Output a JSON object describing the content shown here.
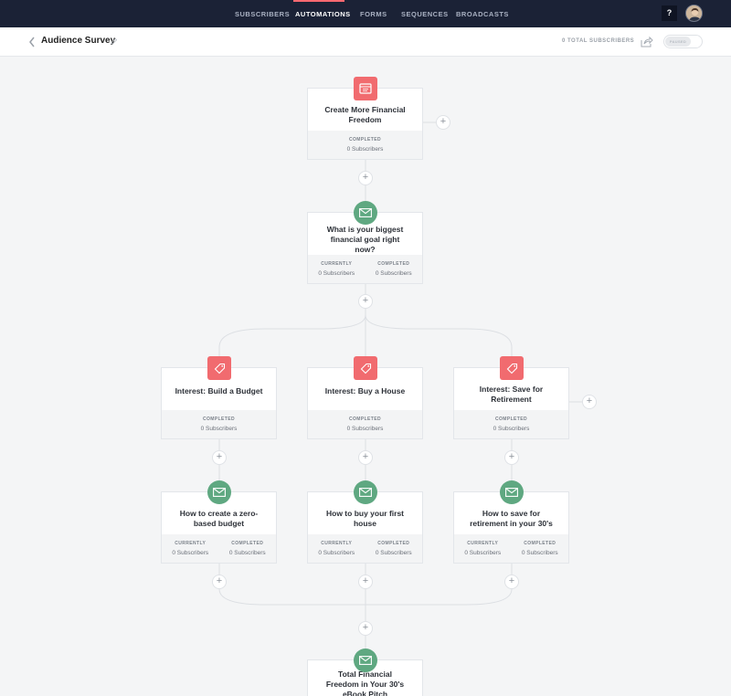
{
  "nav": {
    "items": [
      {
        "label": "SUBSCRIBERS",
        "active": false
      },
      {
        "label": "AUTOMATIONS",
        "active": true
      },
      {
        "label": "FORMS",
        "active": false
      },
      {
        "label": "SEQUENCES",
        "active": false
      },
      {
        "label": "BROADCASTS",
        "active": false
      }
    ],
    "help_label": "?",
    "accent_color": "#fb6970",
    "background_color": "#1b2236"
  },
  "subheader": {
    "title": "Audience Survey",
    "subscriber_count": "0 TOTAL SUBSCRIBERS",
    "toggle_label": "PAUSED"
  },
  "icons": {
    "back": "chevron-left-icon",
    "edit": "pencil-icon",
    "share": "share-icon",
    "action": "tag-icon",
    "form": "form-icon",
    "email": "envelope-icon"
  },
  "colors": {
    "action_node": "#f16b6f",
    "email_node": "#5fa881",
    "canvas": "#f4f5f6"
  },
  "nodes": {
    "trigger": {
      "title": "Create More Financial Freedom",
      "stats": [
        {
          "label": "COMPLETED",
          "value": "0 Subscribers"
        }
      ]
    },
    "survey_email": {
      "title": "What is your biggest financial goal right now?",
      "stats": [
        {
          "label": "CURRENTLY",
          "value": "0 Subscribers"
        },
        {
          "label": "COMPLETED",
          "value": "0 Subscribers"
        }
      ]
    },
    "tag_budget": {
      "title": "Interest: Build a Budget",
      "stats": [
        {
          "label": "COMPLETED",
          "value": "0 Subscribers"
        }
      ]
    },
    "tag_house": {
      "title": "Interest: Buy a House",
      "stats": [
        {
          "label": "COMPLETED",
          "value": "0 Subscribers"
        }
      ]
    },
    "tag_retirement": {
      "title": "Interest: Save for Retirement",
      "stats": [
        {
          "label": "COMPLETED",
          "value": "0 Subscribers"
        }
      ]
    },
    "email_budget": {
      "title": "How to create a zero-based budget",
      "stats": [
        {
          "label": "CURRENTLY",
          "value": "0 Subscribers"
        },
        {
          "label": "COMPLETED",
          "value": "0 Subscribers"
        }
      ]
    },
    "email_house": {
      "title": "How to buy your first house",
      "stats": [
        {
          "label": "CURRENTLY",
          "value": "0 Subscribers"
        },
        {
          "label": "COMPLETED",
          "value": "0 Subscribers"
        }
      ]
    },
    "email_retirement": {
      "title": "How to save for retirement in your 30's",
      "stats": [
        {
          "label": "CURRENTLY",
          "value": "0 Subscribers"
        },
        {
          "label": "COMPLETED",
          "value": "0 Subscribers"
        }
      ]
    },
    "final_email": {
      "title": "Total Financial Freedom in Your 30's eBook Pitch",
      "stats": []
    }
  },
  "add_step_symbol": "+"
}
